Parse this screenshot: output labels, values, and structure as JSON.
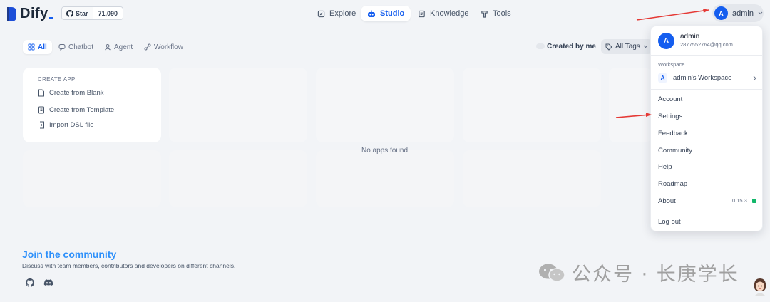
{
  "app": {
    "name": "Dify"
  },
  "github": {
    "star_label": "Star",
    "count": "71,090"
  },
  "nav": [
    {
      "label": "Explore",
      "icon": "compass-icon"
    },
    {
      "label": "Studio",
      "icon": "robot-icon",
      "active": true
    },
    {
      "label": "Knowledge",
      "icon": "book-icon"
    },
    {
      "label": "Tools",
      "icon": "hammer-icon"
    }
  ],
  "user": {
    "initial": "A",
    "name": "admin"
  },
  "filters": {
    "tabs": [
      {
        "label": "All",
        "icon": "grid-icon",
        "active": true
      },
      {
        "label": "Chatbot",
        "icon": "chat-icon"
      },
      {
        "label": "Agent",
        "icon": "agent-icon"
      },
      {
        "label": "Workflow",
        "icon": "workflow-icon"
      }
    ],
    "created_by_me": "Created by me",
    "all_tags": "All Tags"
  },
  "create_app": {
    "title": "CREATE APP",
    "items": [
      "Create from Blank",
      "Create from Template",
      "Import DSL file"
    ]
  },
  "empty_message": "No apps found",
  "community": {
    "title": "Join the community",
    "description": "Discuss with team members, contributors and developers on different channels."
  },
  "menu": {
    "user_name": "admin",
    "email": "2877552764@qq.com",
    "workspace_label": "Workspace",
    "workspace_initial": "A",
    "workspace_name": "admin's Workspace",
    "items": [
      "Account",
      "Settings",
      "Feedback",
      "Community",
      "Help",
      "Roadmap",
      "About"
    ],
    "version": "0.15.3",
    "logout": "Log out"
  },
  "watermark": {
    "text": "公众号 · 长庚学长"
  },
  "colors": {
    "accent": "#155eef",
    "annotation_arrow": "#e53935",
    "community": "#2e90fa",
    "status": "#12b76a"
  }
}
